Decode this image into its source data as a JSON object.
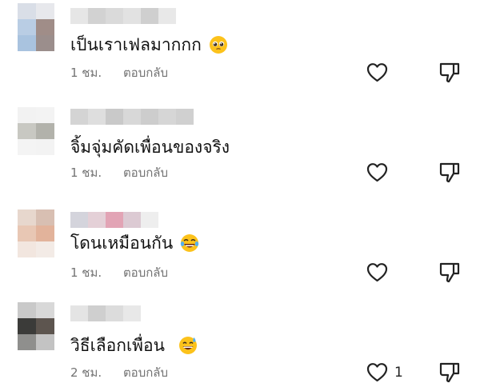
{
  "comments": [
    {
      "text": "เป็นเราเฟลมากกก",
      "emoji": "pleading-face-emoji",
      "time": "1 ชม.",
      "reply": "ตอบกลับ",
      "likes": "",
      "avatar_colors": [
        "#d9dee7",
        "#e7e8ec",
        "#b9cde4",
        "#a08d88",
        "#a9c3df",
        "#9b8e8c"
      ],
      "username_blocks": [
        "#e6e6e6",
        "#d2d2d2",
        "#dadada",
        "#e2e2e2",
        "#cfcfcf",
        "#e8e8e8"
      ]
    },
    {
      "text": "จิ้มจุ่มคัดเพื่อนของจริง",
      "emoji": "",
      "time": "1 ชม.",
      "reply": "ตอบกลับ",
      "likes": "",
      "avatar_colors": [
        "#f2f2f2",
        "#f3f3f3",
        "#c8c8c2",
        "#b2b2ab",
        "#f4f4f4",
        "#f3f3f3"
      ],
      "username_blocks": [
        "#d4d4d4",
        "#dedede",
        "#c9c9c9",
        "#d8d8d8",
        "#cdcdcd",
        "#d6d6d6",
        "#d0d0d0"
      ]
    },
    {
      "text": "โดนเหมือนกัน",
      "emoji": "face-with-tears-of-joy-emoji",
      "time": "1 ชม.",
      "reply": "ตอบกลับ",
      "likes": "",
      "avatar_colors": [
        "#e7d7cd",
        "#d8bfb2",
        "#e8c7b4",
        "#e2b39b",
        "#f2e6df",
        "#f3ebe6"
      ],
      "username_blocks": [
        "#d4d4dc",
        "#e4d0d7",
        "#e2a4b5",
        "#dccad3",
        "#eeeeee"
      ]
    },
    {
      "text": "วิธีเลือกเพื่อน",
      "emoji": "grinning-sweat-emoji",
      "time": "2 ชม.",
      "reply": "ตอบกลับ",
      "likes": "1",
      "avatar_colors": [
        "#c9c9c9",
        "#d8d8d8",
        "#3b3b39",
        "#5d554f",
        "#8f8f8d",
        "#c3c3c3"
      ],
      "username_blocks": [
        "#e4e4e4",
        "#cfcfcf",
        "#dcdcdc",
        "#e8e8e8"
      ]
    }
  ]
}
